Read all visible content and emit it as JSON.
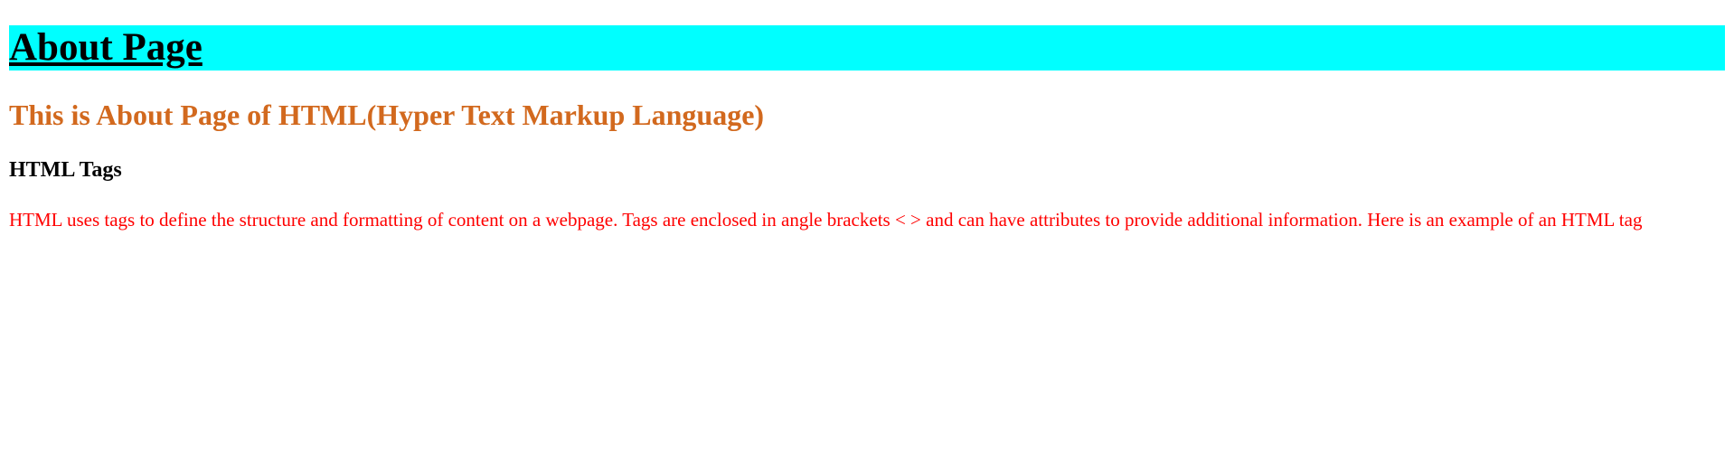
{
  "page": {
    "title": "About Page",
    "subtitle": "This is About Page of HTML(Hyper Text Markup Language)",
    "section_heading": "HTML Tags",
    "paragraph": "HTML uses tags to define the structure and formatting of content on a webpage. Tags are enclosed in angle brackets < > and can have attributes to provide additional information. Here is an example of an HTML tag"
  },
  "colors": {
    "title_background": "#00ffff",
    "subtitle_text": "#d2691e",
    "paragraph_text": "#ff0000",
    "heading_text": "#000000"
  }
}
